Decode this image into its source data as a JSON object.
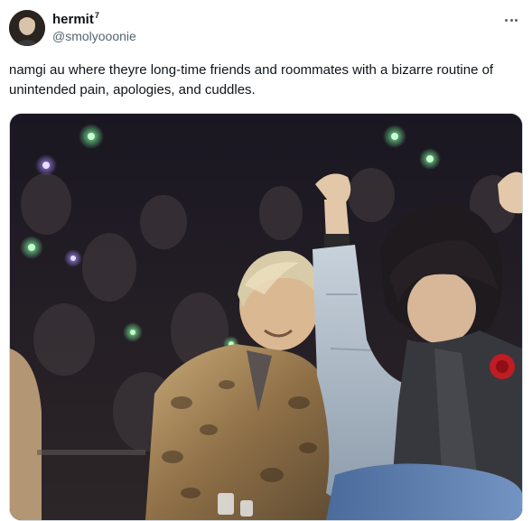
{
  "tweet": {
    "author": {
      "display_name": "hermit",
      "display_name_suffix": "7",
      "handle": "@smolyooonie",
      "avatar_icon": "profile-photo"
    },
    "more_icon": "more-options-icon",
    "text": "namgi au where theyre long-time friends and roommates with a bizarre routine of unintended pain, apologies, and cuddles.",
    "media": {
      "type": "photo",
      "icon": "concert-photo"
    }
  },
  "colors": {
    "text_primary": "#0f1419",
    "text_secondary": "#536471",
    "border": "#cfd9de",
    "background": "#ffffff"
  }
}
